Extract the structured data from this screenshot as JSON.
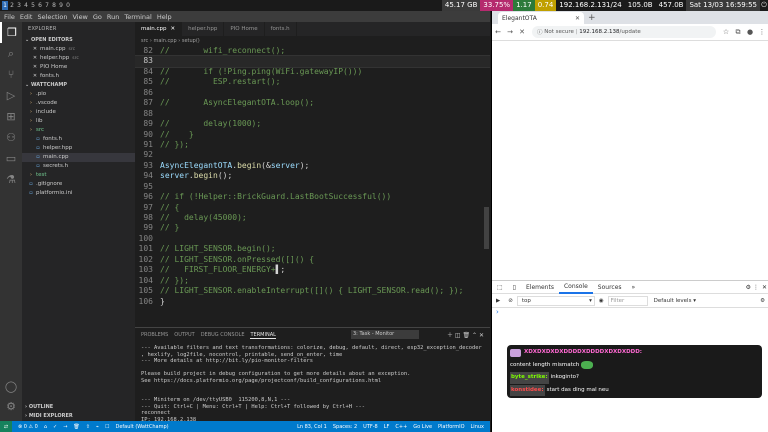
{
  "system_bar": {
    "workspaces": [
      "1",
      "2",
      "3",
      "4",
      "5",
      "6",
      "7",
      "8",
      "9",
      "0"
    ],
    "active_workspace_index": 0,
    "stats": [
      {
        "label": "45.17 GB",
        "color": "#3a3a3a"
      },
      {
        "label": "33.75%",
        "color": "#b52a6e"
      },
      {
        "label": "1.17",
        "color": "#2d7a3a"
      },
      {
        "label": "0.74",
        "color": "#c0a000"
      },
      {
        "label": "192.168.2.131/24",
        "color": "#1a1a1a"
      },
      {
        "label": "105.0B",
        "color": "#1a1a1a"
      },
      {
        "label": "457.0B",
        "color": "#1a1a1a"
      },
      {
        "label": "Sat 13/03 16:59:55",
        "color": "#3a3a3a"
      }
    ]
  },
  "vscode": {
    "menu": [
      "File",
      "Edit",
      "Selection",
      "View",
      "Go",
      "Run",
      "Terminal",
      "Help"
    ],
    "explorer_title": "EXPLORER",
    "open_editors_title": "OPEN EDITORS",
    "open_editors": [
      "main.cpp",
      "helper.hpp",
      "PIO Home",
      "fonts.h"
    ],
    "open_editors_hints": [
      "src",
      "src",
      "",
      ""
    ],
    "project_title": "WATTCHAMP",
    "tree": [
      {
        "label": ".pio",
        "kind": "folder"
      },
      {
        "label": ".vscode",
        "kind": "folder"
      },
      {
        "label": "include",
        "kind": "folder"
      },
      {
        "label": "lib",
        "kind": "folder"
      },
      {
        "label": "src",
        "kind": "folder"
      },
      {
        "label": "fonts.h",
        "kind": "file",
        "indent": 1
      },
      {
        "label": "helper.hpp",
        "kind": "file",
        "indent": 1
      },
      {
        "label": "main.cpp",
        "kind": "file",
        "indent": 1,
        "selected": true
      },
      {
        "label": "secrets.h",
        "kind": "file",
        "indent": 1
      },
      {
        "label": "test",
        "kind": "folder"
      },
      {
        "label": ".gitignore",
        "kind": "file"
      },
      {
        "label": "platformio.ini",
        "kind": "file"
      }
    ],
    "outline_title": "OUTLINE",
    "midi_title": "MIDI EXPLORER",
    "tabs": [
      "main.cpp",
      "helper.hpp",
      "PIO Home",
      "fonts.h"
    ],
    "active_tab_index": 0,
    "breadcrumb": "src › main.cpp › setup()",
    "code_lines": [
      {
        "n": "82",
        "segments": [
          [
            "c",
            "//       wifi_reconnect();"
          ]
        ]
      },
      {
        "n": "83",
        "current": true,
        "segments": [
          [
            "d",
            ""
          ]
        ]
      },
      {
        "n": "84",
        "segments": [
          [
            "c",
            "//       if (!Ping.ping(WiFi.gatewayIP()))"
          ]
        ]
      },
      {
        "n": "85",
        "segments": [
          [
            "c",
            "//         ESP.restart();"
          ]
        ]
      },
      {
        "n": "86",
        "segments": [
          [
            "d",
            ""
          ]
        ]
      },
      {
        "n": "87",
        "segments": [
          [
            "c",
            "//       AsyncElegantOTA.loop();"
          ]
        ]
      },
      {
        "n": "88",
        "segments": [
          [
            "d",
            ""
          ]
        ]
      },
      {
        "n": "89",
        "segments": [
          [
            "c",
            "//       delay(1000);"
          ]
        ]
      },
      {
        "n": "90",
        "segments": [
          [
            "c",
            "//    }"
          ]
        ]
      },
      {
        "n": "91",
        "segments": [
          [
            "c",
            "// });"
          ]
        ]
      },
      {
        "n": "92",
        "segments": [
          [
            "d",
            ""
          ]
        ]
      },
      {
        "n": "93",
        "segments": [
          [
            "v",
            "AsyncElegantOTA"
          ],
          [
            "d",
            "."
          ],
          [
            "f",
            "begin"
          ],
          [
            "d",
            "(&"
          ],
          [
            "v",
            "server"
          ],
          [
            "d",
            ");"
          ]
        ]
      },
      {
        "n": "94",
        "segments": [
          [
            "v",
            "server"
          ],
          [
            "d",
            "."
          ],
          [
            "f",
            "begin"
          ],
          [
            "d",
            "();"
          ]
        ]
      },
      {
        "n": "95",
        "segments": [
          [
            "d",
            ""
          ]
        ]
      },
      {
        "n": "96",
        "segments": [
          [
            "c",
            "// if (!Helper::BrickGuard.LastBootSuccessful())"
          ]
        ]
      },
      {
        "n": "97",
        "segments": [
          [
            "c",
            "// {"
          ]
        ]
      },
      {
        "n": "98",
        "segments": [
          [
            "c",
            "//   delay(45000);"
          ]
        ]
      },
      {
        "n": "99",
        "segments": [
          [
            "c",
            "// }"
          ]
        ]
      },
      {
        "n": "100",
        "segments": [
          [
            "d",
            ""
          ]
        ]
      },
      {
        "n": "101",
        "segments": [
          [
            "c",
            "// LIGHT_SENSOR.begin();"
          ]
        ]
      },
      {
        "n": "102",
        "segments": [
          [
            "c",
            "// LIGHT_SENSOR.onPressed([]() {"
          ]
        ]
      },
      {
        "n": "103",
        "segments": [
          [
            "c",
            "//   FIRST_FLOOR_ENERGY+"
          ],
          [
            "d",
            "▌;"
          ]
        ]
      },
      {
        "n": "104",
        "segments": [
          [
            "c",
            "// });"
          ]
        ]
      },
      {
        "n": "105",
        "segments": [
          [
            "c",
            "// LIGHT_SENSOR.enableInterrupt([]() { LIGHT_SENSOR.read(); });"
          ]
        ]
      },
      {
        "n": "106",
        "segments": [
          [
            "d",
            "}"
          ]
        ]
      }
    ],
    "panel_tabs": [
      "PROBLEMS",
      "OUTPUT",
      "DEBUG CONSOLE",
      "TERMINAL"
    ],
    "active_panel_tab_index": 3,
    "terminal_selector": "3: Task - Monitor",
    "terminal_lines": [
      "--- Available filters and text transformations: colorize, debug, default, direct, esp32_exception_decoder",
      ", hexlify, log2file, nocontrol, printable, send_on_enter, time",
      "--- More details at http://bit.ly/pio-monitor-filters",
      "",
      "Please build project in debug configuration to get more details about an exception.",
      "See https://docs.platformio.org/page/projectconf/build_configurations.html",
      "",
      "",
      "--- Miniterm on /dev/ttyUSB0  115200,8,N,1 ---",
      "--- Quit: Ctrl+C | Menu: Ctrl+T | Help: Ctrl+T followed by Ctrl+H ---",
      "reconnect",
      "IP: 192.168.2.138"
    ],
    "status_items": [
      "⊗ 0 ⚠ 0",
      "⌂",
      "✓",
      "→",
      "🗑",
      "⇧",
      "⌁",
      "☐",
      "Default (WattChamp)"
    ],
    "status_right": [
      "Ln 83, Col 1",
      "Spaces: 2",
      "UTF-8",
      "LF",
      "C++",
      "Go Live",
      "PlatformIO",
      "Linux"
    ]
  },
  "chrome": {
    "tab_title": "ElegantOTA",
    "url_prefix": "Not secure",
    "url_host": "192.168.2.138",
    "url_path": "/update",
    "devtools_tabs": [
      "Elements",
      "Console",
      "Sources",
      "»"
    ],
    "active_devtools_tab_index": 1,
    "context": "top",
    "filter_placeholder": "Filter",
    "levels_label": "Default levels ▾",
    "prompt": "›"
  },
  "chat": {
    "messages": [
      {
        "user": "XDXDXDXDXDDDDXDDDDXDXDXDDD:",
        "text": "",
        "user_color": "#ff69d2",
        "user_bg": "",
        "has_avatar": true
      },
      {
        "user": "",
        "text": "content length mismatch",
        "user_color": "#fff",
        "user_bg": "",
        "has_frog": true
      },
      {
        "user": "byte_strike:",
        "text": "inkoginto?",
        "user_color": "#7cfc00",
        "user_bg": "#444"
      },
      {
        "user": "konstidee:",
        "text": "start das ding mal neu",
        "user_color": "#ff4d4d",
        "user_bg": "#444"
      }
    ]
  }
}
